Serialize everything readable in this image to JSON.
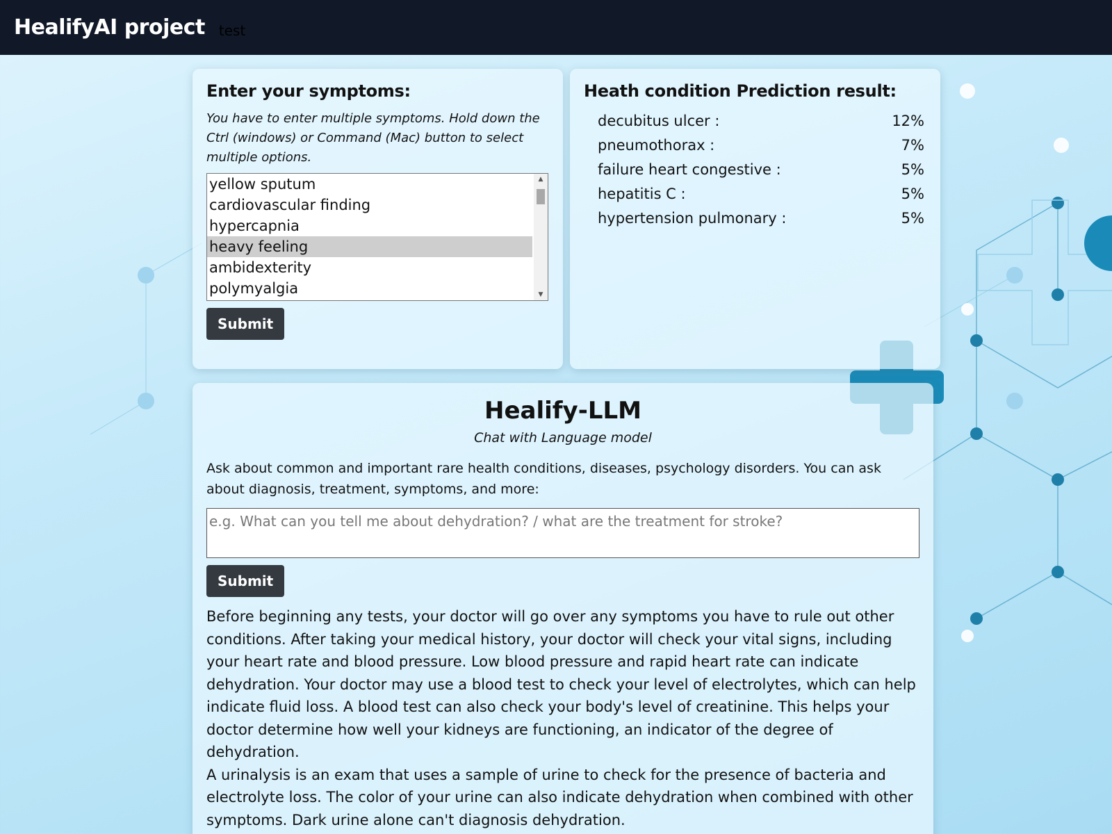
{
  "header": {
    "brand": "HealifyAI project",
    "subtitle": "test"
  },
  "symptoms": {
    "title": "Enter your symptoms:",
    "hint": "You have to enter multiple symptoms. Hold down the Ctrl (windows) or Command (Mac) button to select multiple options.",
    "options": [
      {
        "label": "yellow sputum",
        "selected": false
      },
      {
        "label": "cardiovascular finding",
        "selected": false
      },
      {
        "label": "hypercapnia",
        "selected": false
      },
      {
        "label": "heavy feeling",
        "selected": true
      },
      {
        "label": "ambidexterity",
        "selected": false
      },
      {
        "label": "polymyalgia",
        "selected": false
      }
    ],
    "submit_label": "Submit"
  },
  "prediction": {
    "title": "Heath condition Prediction result:",
    "results": [
      {
        "condition": "decubitus ulcer :",
        "percent": "12%"
      },
      {
        "condition": "pneumothorax :",
        "percent": "7%"
      },
      {
        "condition": "failure heart congestive :",
        "percent": "5%"
      },
      {
        "condition": "hepatitis C :",
        "percent": "5%"
      },
      {
        "condition": "hypertension pulmonary :",
        "percent": "5%"
      }
    ]
  },
  "llm": {
    "title": "Healify-LLM",
    "subtitle": "Chat with Language model",
    "description": "Ask about common and important rare health conditions, diseases, psychology disorders. You can ask about diagnosis, treatment, symptoms, and more:",
    "placeholder": "e.g. What can you tell me about dehydration? / what are the treatment for stroke?",
    "submit_label": "Submit",
    "answer": [
      "Before beginning any tests, your doctor will go over any symptoms you have to rule out other conditions. After taking your medical history, your doctor will check your vital signs, including your heart rate and blood pressure. Low blood pressure and rapid heart rate can indicate dehydration. Your doctor may use a blood test to check your level of electrolytes, which can help indicate fluid loss. A blood test can also check your body's level of creatinine. This helps your doctor determine how well your kidneys are functioning, an indicator of the degree of dehydration.",
      "A urinalysis is an exam that uses a sample of urine to check for the presence of bacteria and electrolyte loss. The color of your urine can also indicate dehydration when combined with other symptoms. Dark urine alone can't diagnosis dehydration."
    ]
  },
  "theme": {
    "topbar": "#111827",
    "button": "#343a40",
    "accent": "#1a8bb8"
  }
}
